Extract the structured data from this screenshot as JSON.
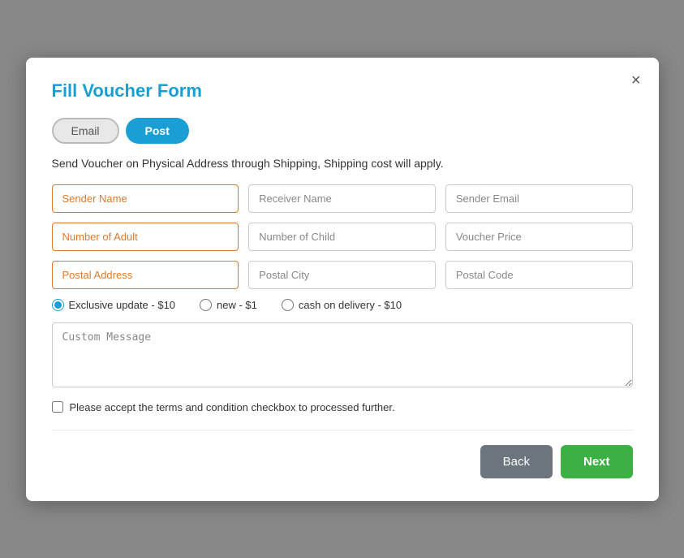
{
  "modal": {
    "title": "Fill Voucher Form",
    "close_label": "×",
    "description": "Send Voucher on Physical Address through Shipping, Shipping cost will apply."
  },
  "tabs": [
    {
      "id": "email",
      "label": "Email",
      "active": false
    },
    {
      "id": "post",
      "label": "Post",
      "active": true
    }
  ],
  "form": {
    "row1": [
      {
        "id": "sender-name",
        "placeholder": "Sender Name",
        "highlight": true
      },
      {
        "id": "receiver-name",
        "placeholder": "Receiver Name",
        "highlight": false
      },
      {
        "id": "sender-email",
        "placeholder": "Sender Email",
        "highlight": false
      }
    ],
    "row2": [
      {
        "id": "number-of-adult",
        "placeholder": "Number of Adult",
        "highlight": true
      },
      {
        "id": "number-of-child",
        "placeholder": "Number of Child",
        "highlight": false
      },
      {
        "id": "voucher-price",
        "placeholder": "Voucher Price",
        "highlight": false
      }
    ],
    "row3": [
      {
        "id": "postal-address",
        "placeholder": "Postal Address",
        "highlight": true
      },
      {
        "id": "postal-city",
        "placeholder": "Postal City",
        "highlight": false
      },
      {
        "id": "postal-code",
        "placeholder": "Postal Code",
        "highlight": false
      }
    ],
    "radio_options": [
      {
        "id": "exclusive",
        "label": "Exclusive update - $10",
        "checked": true
      },
      {
        "id": "new",
        "label": "new - $1",
        "checked": false
      },
      {
        "id": "cash",
        "label": "cash on delivery - $10",
        "checked": false
      }
    ],
    "custom_message_placeholder": "Custom Message",
    "terms_label": "Please accept the terms and condition checkbox to processed further."
  },
  "buttons": {
    "back_label": "Back",
    "next_label": "Next"
  }
}
